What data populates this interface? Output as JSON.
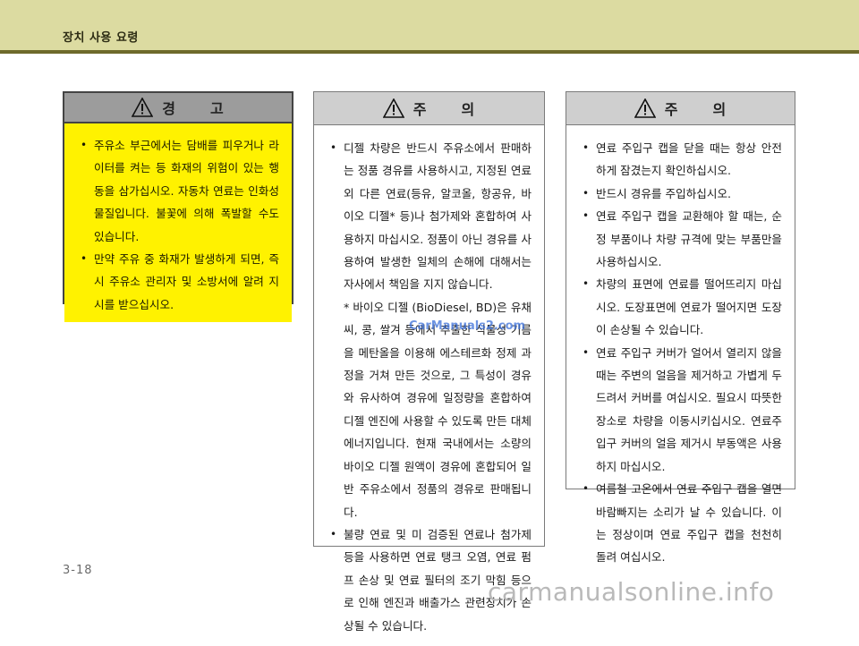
{
  "header": {
    "section_title": "장치 사용 요령"
  },
  "warning_panel": {
    "head_left": "경",
    "head_right": "고",
    "items": [
      "주유소 부근에서는 담배를 피우거나 라이터를 켜는 등 화재의 위험이 있는 행동을 삼가십시오. 자동차 연료는 인화성 물질입니다. 불꽃에 의해 폭발할 수도 있습니다.",
      "만약 주유 중 화재가 발생하게 되면, 즉시 주유소 관리자 및 소방서에 알려 지시를 받으십시오."
    ]
  },
  "caution_panel_1": {
    "head_left": "주",
    "head_right": "의",
    "item1": "디젤 차량은 반드시 주유소에서 판매하는 정품 경유를 사용하시고, 지정된 연료 외 다른 연료(등유, 알코올, 항공유, 바이오 디젤* 등)나 첨가제와 혼합하여 사용하지 마십시오. 정품이 아닌 경유를 사용하여 발생한 일체의 손해에 대해서는 자사에서 책임을 지지 않습니다.",
    "item1_note": "* 바이오 디젤 (BioDiesel, BD)은 유채씨, 콩, 쌀겨 등에서 추출한 식물성 기름을 메탄올을 이용해 에스테르화 정제 과정을 거쳐 만든 것으로, 그 특성이 경유와 유사하여 경유에 일정량을 혼합하여 디젤 엔진에 사용할 수 있도록 만든 대체 에너지입니다. 현재 국내에서는 소량의 바이오 디젤 원액이 경유에 혼합되어 일반 주유소에서 정품의 경유로 판매됩니다.",
    "item2": "불량 연료 및 미 검증된 연료나 첨가제 등을 사용하면 연료 탱크 오염, 연료 펌프 손상 및 연료 필터의 조기 막힘 등으로 인해 엔진과 배출가스 관련장치가 손상될 수 있습니다."
  },
  "caution_panel_2": {
    "head_left": "주",
    "head_right": "의",
    "items": [
      "연료 주입구 캡을 닫을 때는 항상 안전하게 잠겼는지 확인하십시오.",
      "반드시 경유를 주입하십시오.",
      "연료 주입구 캡을 교환해야 할 때는, 순정 부품이나 차량 규격에 맞는 부품만을 사용하십시오.",
      "차량의 표면에 연료를 떨어뜨리지 마십시오. 도장표면에 연료가 떨어지면 도장이 손상될 수 있습니다.",
      "연료 주입구 커버가 얼어서 열리지 않을 때는 주변의 얼음을 제거하고 가볍게 두드려서 커버를 여십시오. 필요시 따뜻한 장소로 차량을 이동시키십시오. 연료주입구 커버의 얼음 제거시 부동액은 사용하지 마십시오.",
      "여름철 고온에서 연료 주입구 캡을 열면 바람빠지는 소리가 날 수 있습니다. 이는 정상이며 연료 주입구 캡을 천천히 돌려 여십시오."
    ]
  },
  "watermark": "CarManuals2.com",
  "page_number": "3-18",
  "footer_watermark": "carmanualsonline.info",
  "colors": {
    "header_band": "#dcdba1",
    "header_rule": "#6e6a2b",
    "warning_fill": "#fff200"
  }
}
